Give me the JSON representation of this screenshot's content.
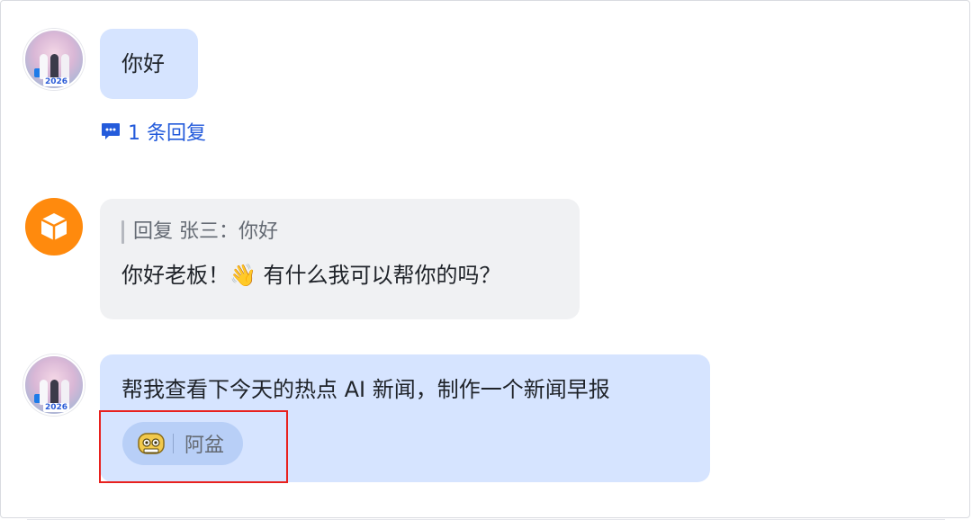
{
  "messages": [
    {
      "sender": "user",
      "text": "你好",
      "reply_count_label": "1 条回复"
    },
    {
      "sender": "bot",
      "quote_label": "回复 张三：你好",
      "text": "你好老板！👋 有什么我可以帮你的吗？"
    },
    {
      "sender": "user",
      "text": "帮我查看下今天的热点 AI 新闻，制作一个新闻早报",
      "mention": {
        "name": "阿盆",
        "icon": "robot-face-icon"
      }
    }
  ],
  "avatar_badge_text": "2026",
  "colors": {
    "user_bubble": "#d6e4ff",
    "bot_bubble": "#f0f1f3",
    "link": "#245bdb",
    "bot_avatar": "#ff8a0d",
    "highlight": "#e8211e"
  }
}
